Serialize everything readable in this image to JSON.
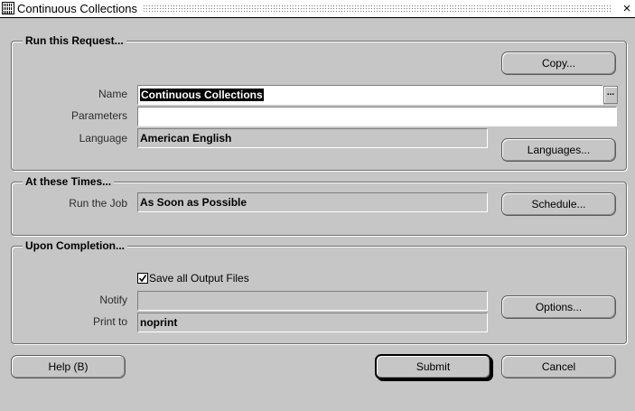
{
  "window": {
    "title": "Continuous Collections",
    "close_glyph": "×"
  },
  "run_request": {
    "section_title": "Run this Request...",
    "copy_button": "Copy...",
    "name_label": "Name",
    "name_value": "Continuous Collections",
    "lov_glyph": "...",
    "parameters_label": "Parameters",
    "parameters_value": "",
    "language_label": "Language",
    "language_value": "American English",
    "languages_button": "Languages..."
  },
  "times": {
    "section_title": "At these Times...",
    "run_job_label": "Run the Job",
    "run_job_value": "As Soon as Possible",
    "schedule_button": "Schedule..."
  },
  "completion": {
    "section_title": "Upon Completion...",
    "save_output_label": "Save all Output Files",
    "save_output_checked": true,
    "notify_label": "Notify",
    "notify_value": "",
    "print_to_label": "Print to",
    "print_to_value": "noprint",
    "options_button": "Options..."
  },
  "footer": {
    "help_button": "Help (B)",
    "submit_button": "Submit",
    "cancel_button": "Cancel"
  }
}
